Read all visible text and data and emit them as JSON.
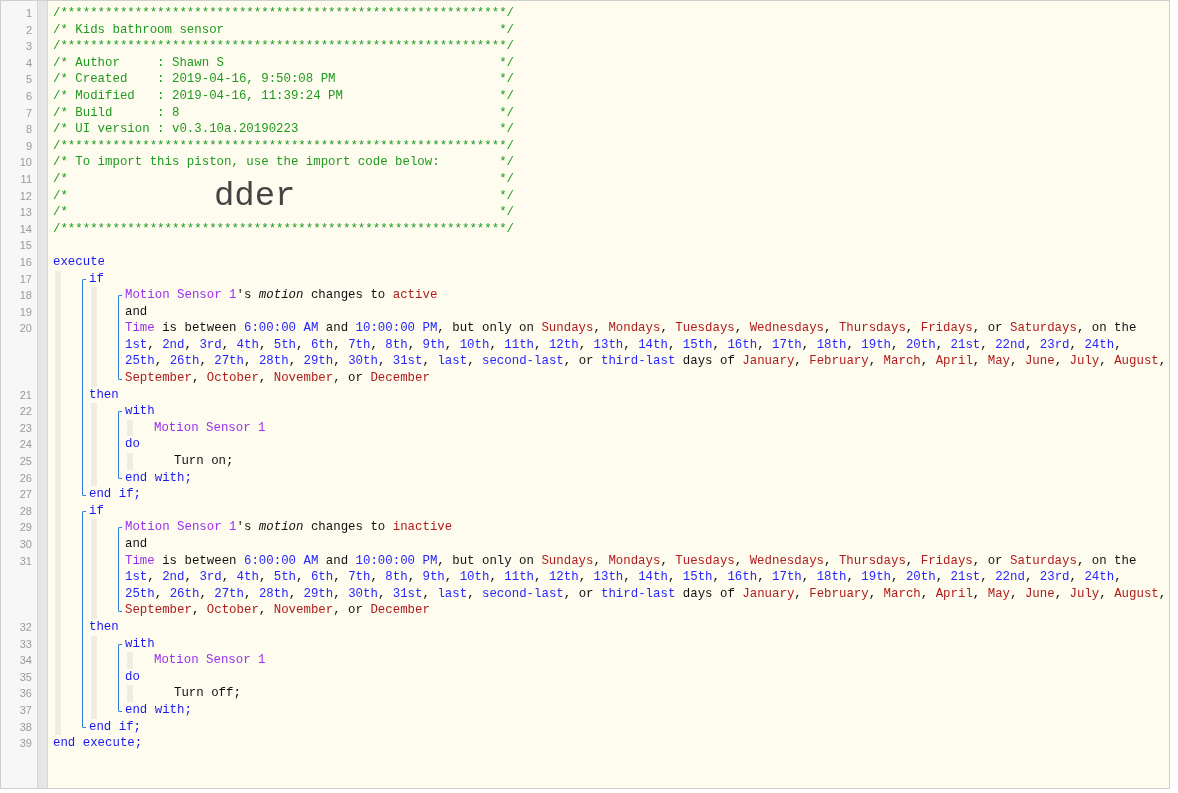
{
  "editor": {
    "lines": [
      {
        "kind": "comment",
        "number": "1",
        "text": "/************************************************************/"
      },
      {
        "kind": "comment",
        "number": "2",
        "text": "/* Kids bathroom sensor",
        "end": "*/"
      },
      {
        "kind": "comment",
        "number": "3",
        "text": "/************************************************************/"
      },
      {
        "kind": "comment",
        "number": "4",
        "text": "/* Author     : Shawn S",
        "end": "*/"
      },
      {
        "kind": "comment",
        "number": "5",
        "text": "/* Created    : 2019-04-16, 9:50:08 PM",
        "end": "*/"
      },
      {
        "kind": "comment",
        "number": "6",
        "text": "/* Modified   : 2019-04-16, 11:39:24 PM",
        "end": "*/"
      },
      {
        "kind": "comment",
        "number": "7",
        "text": "/* Build      : 8",
        "end": "*/"
      },
      {
        "kind": "comment",
        "number": "8",
        "text": "/* UI version : v0.3.10a.20190223",
        "end": "*/"
      },
      {
        "kind": "comment",
        "number": "9",
        "text": "/************************************************************/"
      },
      {
        "kind": "comment",
        "number": "10",
        "text": "/* To import this piston, use the import code below:",
        "end": "*/"
      },
      {
        "kind": "comment",
        "number": "11",
        "text": "/*",
        "end": "*/"
      },
      {
        "kind": "comment",
        "number": "12",
        "text": "/*",
        "code": "dder",
        "end": "*/"
      },
      {
        "kind": "comment",
        "number": "13",
        "text": "/*",
        "end": "*/"
      },
      {
        "kind": "comment",
        "number": "14",
        "text": "/************************************************************/"
      },
      {
        "kind": "blank",
        "number": "15"
      },
      {
        "kind": "row",
        "number": "16",
        "tokens": [
          {
            "kind": "keyword",
            "text": "execute"
          }
        ]
      },
      {
        "kind": "indent",
        "children": [
          {
            "kind": "bracket",
            "children": [
              {
                "kind": "row",
                "number": "17",
                "tokens": [
                  {
                    "kind": "keyword",
                    "text": "if"
                  }
                ]
              },
              {
                "kind": "indent",
                "children": [
                  {
                    "kind": "bracket",
                    "children": [
                      {
                        "kind": "row",
                        "number": "18",
                        "tokens": [
                          {
                            "kind": "device",
                            "text": "Motion Sensor 1"
                          },
                          {
                            "kind": "text",
                            "text": "'s "
                          },
                          {
                            "kind": "attribute",
                            "text": "motion"
                          },
                          {
                            "kind": "text",
                            "text": " changes to "
                          },
                          {
                            "kind": "value",
                            "text": "active"
                          }
                        ]
                      },
                      {
                        "kind": "row",
                        "number": "19",
                        "tokens": [
                          {
                            "kind": "text",
                            "text": "and"
                          }
                        ]
                      },
                      {
                        "kind": "row",
                        "number": "20",
                        "tokens": [
                          {
                            "kind": "device",
                            "text": "Time"
                          },
                          {
                            "kind": "text",
                            "text": " is between "
                          },
                          {
                            "kind": "literal",
                            "text": "6:00:00 AM"
                          },
                          {
                            "kind": "text",
                            "text": " and "
                          },
                          {
                            "kind": "literal",
                            "text": "10:00:00 PM"
                          },
                          {
                            "kind": "text",
                            "text": ", but only on "
                          },
                          {
                            "kind": "value_list",
                            "sep": ", ",
                            "items": [
                              "Sundays",
                              "Mondays",
                              "Tuesdays",
                              "Wednesdays",
                              "Thursdays",
                              "Fridays"
                            ]
                          },
                          {
                            "kind": "text",
                            "text": ", or "
                          },
                          {
                            "kind": "value",
                            "text": "Saturdays"
                          },
                          {
                            "kind": "text",
                            "text": ", on the"
                          }
                        ]
                      },
                      {
                        "kind": "row",
                        "tokens": [
                          {
                            "kind": "literal_list",
                            "sep": ", ",
                            "items": [
                              "1st",
                              "2nd",
                              "3rd",
                              "4th",
                              "5th",
                              "6th",
                              "7th",
                              "8th",
                              "9th",
                              "10th",
                              "11th",
                              "12th",
                              "13th",
                              "14th",
                              "15th",
                              "16th",
                              "17th",
                              "18th",
                              "19th",
                              "20th",
                              "21st",
                              "22nd",
                              "23rd",
                              "24th"
                            ]
                          },
                          {
                            "kind": "text",
                            "text": ","
                          }
                        ]
                      },
                      {
                        "kind": "row",
                        "tokens": [
                          {
                            "kind": "literal_list",
                            "sep": ", ",
                            "items": [
                              "25th",
                              "26th",
                              "27th",
                              "28th",
                              "29th",
                              "30th",
                              "31st",
                              "last",
                              "second-last"
                            ]
                          },
                          {
                            "kind": "text",
                            "text": ", or "
                          },
                          {
                            "kind": "literal",
                            "text": "third-last"
                          },
                          {
                            "kind": "text",
                            "text": " days of "
                          },
                          {
                            "kind": "value_list",
                            "sep": ", ",
                            "items": [
                              "January",
                              "February",
                              "March",
                              "April",
                              "May",
                              "June",
                              "July",
                              "August"
                            ]
                          },
                          {
                            "kind": "text",
                            "text": ","
                          }
                        ]
                      },
                      {
                        "kind": "row",
                        "tokens": [
                          {
                            "kind": "value_list",
                            "sep": ", ",
                            "items": [
                              "September",
                              "October",
                              "November"
                            ]
                          },
                          {
                            "kind": "text",
                            "text": ", or "
                          },
                          {
                            "kind": "value",
                            "text": "December"
                          }
                        ]
                      }
                    ]
                  }
                ]
              },
              {
                "kind": "row",
                "number": "21",
                "tokens": [
                  {
                    "kind": "keyword",
                    "text": "then"
                  }
                ]
              },
              {
                "kind": "indent",
                "children": [
                  {
                    "kind": "bracket",
                    "children": [
                      {
                        "kind": "row",
                        "number": "22",
                        "tokens": [
                          {
                            "kind": "keyword",
                            "text": "with"
                          }
                        ]
                      },
                      {
                        "kind": "indent",
                        "children": [
                          {
                            "kind": "row",
                            "number": "23",
                            "tokens": [
                              {
                                "kind": "device",
                                "text": "Motion Sensor 1"
                              }
                            ]
                          }
                        ]
                      },
                      {
                        "kind": "row",
                        "number": "24",
                        "tokens": [
                          {
                            "kind": "keyword",
                            "text": "do"
                          }
                        ]
                      },
                      {
                        "kind": "indent",
                        "children": [
                          {
                            "kind": "row",
                            "number": "25",
                            "tokens": [
                              {
                                "kind": "command",
                                "text": "Turn on;"
                              }
                            ]
                          }
                        ]
                      },
                      {
                        "kind": "row",
                        "number": "26",
                        "tokens": [
                          {
                            "kind": "keyword",
                            "text": "end with;"
                          }
                        ]
                      }
                    ]
                  }
                ]
              },
              {
                "kind": "row",
                "number": "27",
                "tokens": [
                  {
                    "kind": "keyword",
                    "text": "end if;"
                  }
                ]
              }
            ]
          },
          {
            "kind": "bracket",
            "children": [
              {
                "kind": "row",
                "number": "28",
                "tokens": [
                  {
                    "kind": "keyword",
                    "text": "if"
                  }
                ]
              },
              {
                "kind": "indent",
                "children": [
                  {
                    "kind": "bracket",
                    "children": [
                      {
                        "kind": "row",
                        "number": "29",
                        "tokens": [
                          {
                            "kind": "device",
                            "text": "Motion Sensor 1"
                          },
                          {
                            "kind": "text",
                            "text": "'s "
                          },
                          {
                            "kind": "attribute",
                            "text": "motion"
                          },
                          {
                            "kind": "text",
                            "text": " changes to "
                          },
                          {
                            "kind": "value",
                            "text": "inactive"
                          }
                        ]
                      },
                      {
                        "kind": "row",
                        "number": "30",
                        "tokens": [
                          {
                            "kind": "text",
                            "text": "and"
                          }
                        ]
                      },
                      {
                        "kind": "row",
                        "number": "31",
                        "tokens": [
                          {
                            "kind": "device",
                            "text": "Time"
                          },
                          {
                            "kind": "text",
                            "text": " is between "
                          },
                          {
                            "kind": "literal",
                            "text": "6:00:00 AM"
                          },
                          {
                            "kind": "text",
                            "text": " and "
                          },
                          {
                            "kind": "literal",
                            "text": "10:00:00 PM"
                          },
                          {
                            "kind": "text",
                            "text": ", but only on "
                          },
                          {
                            "kind": "value_list",
                            "sep": ", ",
                            "items": [
                              "Sundays",
                              "Mondays",
                              "Tuesdays",
                              "Wednesdays",
                              "Thursdays",
                              "Fridays"
                            ]
                          },
                          {
                            "kind": "text",
                            "text": ", or "
                          },
                          {
                            "kind": "value",
                            "text": "Saturdays"
                          },
                          {
                            "kind": "text",
                            "text": ", on the"
                          }
                        ]
                      },
                      {
                        "kind": "row",
                        "tokens": [
                          {
                            "kind": "literal_list",
                            "sep": ", ",
                            "items": [
                              "1st",
                              "2nd",
                              "3rd",
                              "4th",
                              "5th",
                              "6th",
                              "7th",
                              "8th",
                              "9th",
                              "10th",
                              "11th",
                              "12th",
                              "13th",
                              "14th",
                              "15th",
                              "16th",
                              "17th",
                              "18th",
                              "19th",
                              "20th",
                              "21st",
                              "22nd",
                              "23rd",
                              "24th"
                            ]
                          },
                          {
                            "kind": "text",
                            "text": ","
                          }
                        ]
                      },
                      {
                        "kind": "row",
                        "tokens": [
                          {
                            "kind": "literal_list",
                            "sep": ", ",
                            "items": [
                              "25th",
                              "26th",
                              "27th",
                              "28th",
                              "29th",
                              "30th",
                              "31st",
                              "last",
                              "second-last"
                            ]
                          },
                          {
                            "kind": "text",
                            "text": ", or "
                          },
                          {
                            "kind": "literal",
                            "text": "third-last"
                          },
                          {
                            "kind": "text",
                            "text": " days of "
                          },
                          {
                            "kind": "value_list",
                            "sep": ", ",
                            "items": [
                              "January",
                              "February",
                              "March",
                              "April",
                              "May",
                              "June",
                              "July",
                              "August"
                            ]
                          },
                          {
                            "kind": "text",
                            "text": ","
                          }
                        ]
                      },
                      {
                        "kind": "row",
                        "tokens": [
                          {
                            "kind": "value_list",
                            "sep": ", ",
                            "items": [
                              "September",
                              "October",
                              "November"
                            ]
                          },
                          {
                            "kind": "text",
                            "text": ", or "
                          },
                          {
                            "kind": "value",
                            "text": "December"
                          }
                        ]
                      }
                    ]
                  }
                ]
              },
              {
                "kind": "row",
                "number": "32",
                "tokens": [
                  {
                    "kind": "keyword",
                    "text": "then"
                  }
                ]
              },
              {
                "kind": "indent",
                "children": [
                  {
                    "kind": "bracket",
                    "children": [
                      {
                        "kind": "row",
                        "number": "33",
                        "tokens": [
                          {
                            "kind": "keyword",
                            "text": "with"
                          }
                        ]
                      },
                      {
                        "kind": "indent",
                        "children": [
                          {
                            "kind": "row",
                            "number": "34",
                            "tokens": [
                              {
                                "kind": "device",
                                "text": "Motion Sensor 1"
                              }
                            ]
                          }
                        ]
                      },
                      {
                        "kind": "row",
                        "number": "35",
                        "tokens": [
                          {
                            "kind": "keyword",
                            "text": "do"
                          }
                        ]
                      },
                      {
                        "kind": "indent",
                        "children": [
                          {
                            "kind": "row",
                            "number": "36",
                            "tokens": [
                              {
                                "kind": "command",
                                "text": "Turn off;"
                              }
                            ]
                          }
                        ]
                      },
                      {
                        "kind": "row",
                        "number": "37",
                        "tokens": [
                          {
                            "kind": "keyword",
                            "text": "end with;"
                          }
                        ]
                      }
                    ]
                  }
                ]
              },
              {
                "kind": "row",
                "number": "38",
                "tokens": [
                  {
                    "kind": "keyword",
                    "text": "end if;"
                  }
                ]
              }
            ]
          }
        ]
      },
      {
        "kind": "row",
        "number": "39",
        "tokens": [
          {
            "kind": "keyword",
            "text": "end execute;"
          }
        ]
      }
    ]
  }
}
